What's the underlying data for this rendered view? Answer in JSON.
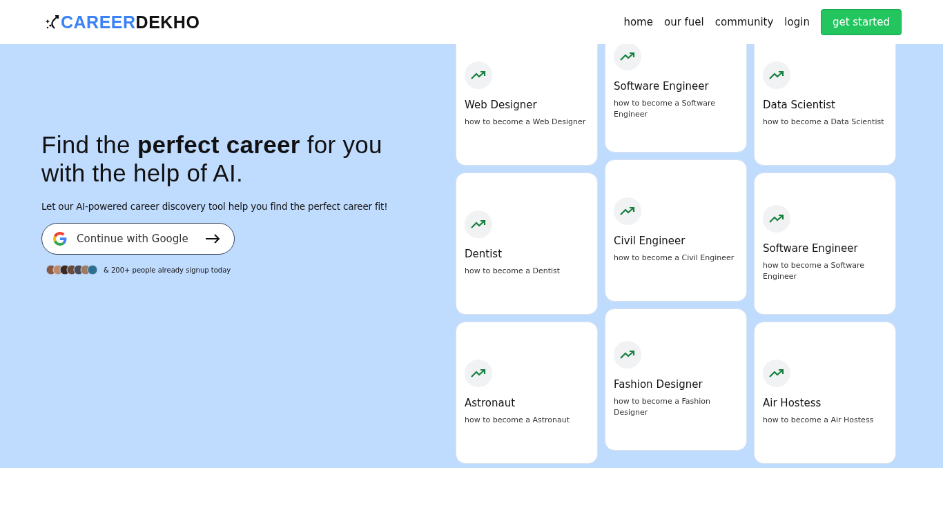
{
  "header": {
    "logo": {
      "part1": "CAREER",
      "part2": "DEKHO"
    },
    "nav": [
      "home",
      "our fuel",
      "community",
      "login"
    ],
    "cta": "get started"
  },
  "hero": {
    "title": "Find the **perfect career** for you with the help of AI.",
    "subtitle": "Let our AI-powered career discovery tool help you find the perfect career fit!",
    "google_button": "Continue with Google",
    "social_proof": "& 200+ people already signup today"
  },
  "career_columns": [
    [
      {
        "title": "Web Designer",
        "description": "how to become a Web Designer"
      },
      {
        "title": "Dentist",
        "description": "how to become a Dentist"
      },
      {
        "title": "Astronaut",
        "description": "how to become a Astronaut"
      }
    ],
    [
      {
        "title": "Software Engineer",
        "description": "how to become a Software Engineer"
      },
      {
        "title": "Civil Engineer",
        "description": "how to become a Civil Engineer"
      },
      {
        "title": "Fashion Designer",
        "description": "how to become a Fashion Designer"
      }
    ],
    [
      {
        "title": "Data Scientist",
        "description": "how to become a Data Scientist"
      },
      {
        "title": "Software Engineer",
        "description": "how to become a Software Engineer"
      },
      {
        "title": "Air Hostess",
        "description": "how to become a Air Hostess"
      }
    ]
  ]
}
